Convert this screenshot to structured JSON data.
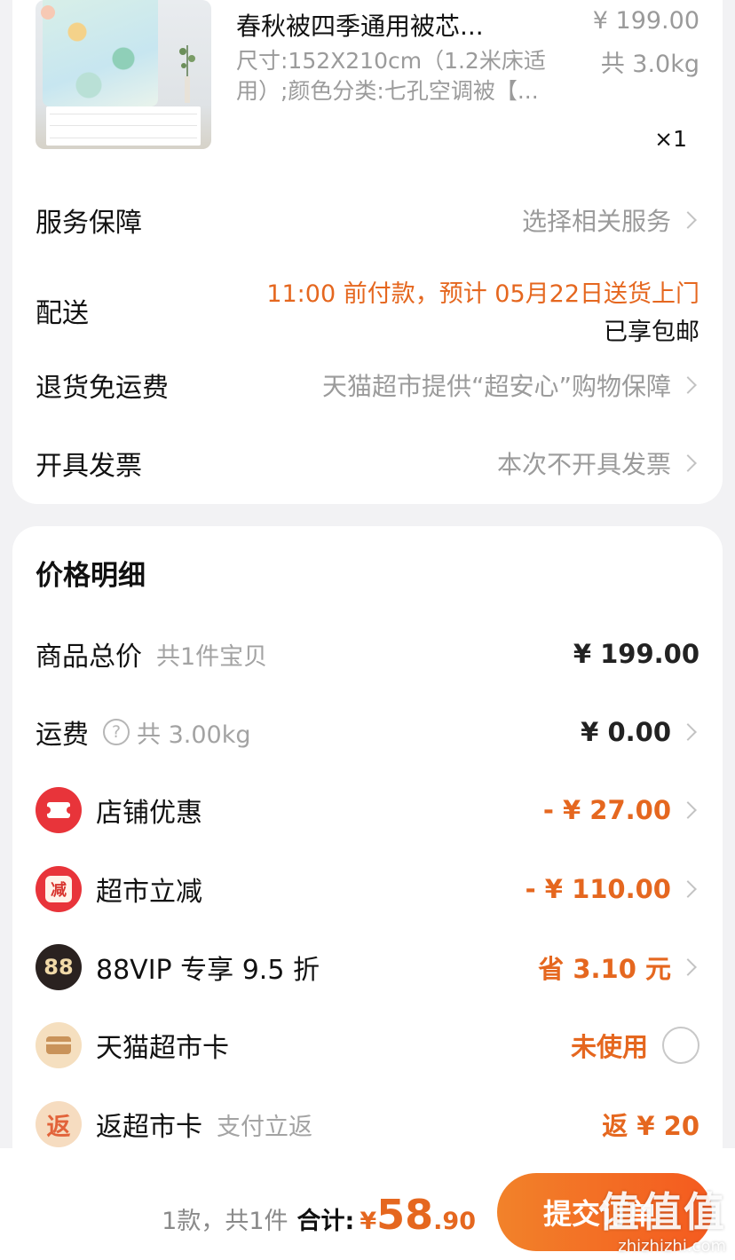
{
  "product": {
    "title": "春秋被四季通用被芯...",
    "spec": "尺寸:152X210cm（1.2米床适用）;颜色分类:七孔空调被【...",
    "price": "¥ 199.00",
    "weight": "共 3.0kg",
    "quantity": "×1"
  },
  "order_rows": {
    "service": {
      "label": "服务保障",
      "value": "选择相关服务"
    },
    "delivery": {
      "label": "配送",
      "line1": "11:00 前付款，预计 05月22日送货上门",
      "line2": "已享包邮"
    },
    "return": {
      "label": "退货免运费",
      "value": "天猫超市提供“超安心”购物保障"
    },
    "invoice": {
      "label": "开具发票",
      "value": "本次不开具发票"
    }
  },
  "price_detail": {
    "title": "价格明细",
    "goods_total": {
      "label": "商品总价",
      "sub": "共1件宝贝",
      "value": "¥ 199.00"
    },
    "shipping": {
      "label": "运费",
      "help": "?",
      "sub": "共 3.00kg",
      "value": "¥ 0.00"
    },
    "store_discount": {
      "label": "店铺优惠",
      "value": "- ¥ 27.00"
    },
    "market_discount": {
      "label": "超市立减",
      "icon_text": "减",
      "value": "- ¥ 110.00"
    },
    "vip": {
      "label": "88VIP 专享 9.5 折",
      "icon_text": "88",
      "value": "省 3.10 元"
    },
    "market_card": {
      "label": "天猫超市卡",
      "value": "未使用"
    },
    "return_card": {
      "label": "返超市卡",
      "sub": "支付立返",
      "icon_text": "返",
      "value": "返 ¥ 20"
    }
  },
  "bottom": {
    "count": "1款，共1件",
    "total_label": "合计:",
    "currency": "¥",
    "total_int": "58",
    "total_dec": ".90",
    "submit": "提交订单"
  },
  "watermark": {
    "main": "值值值",
    "sub": "zhizhizhi.com"
  },
  "colors": {
    "accent": "#e5671f",
    "red_icon": "#e8343a",
    "background": "#f2f2f4"
  }
}
